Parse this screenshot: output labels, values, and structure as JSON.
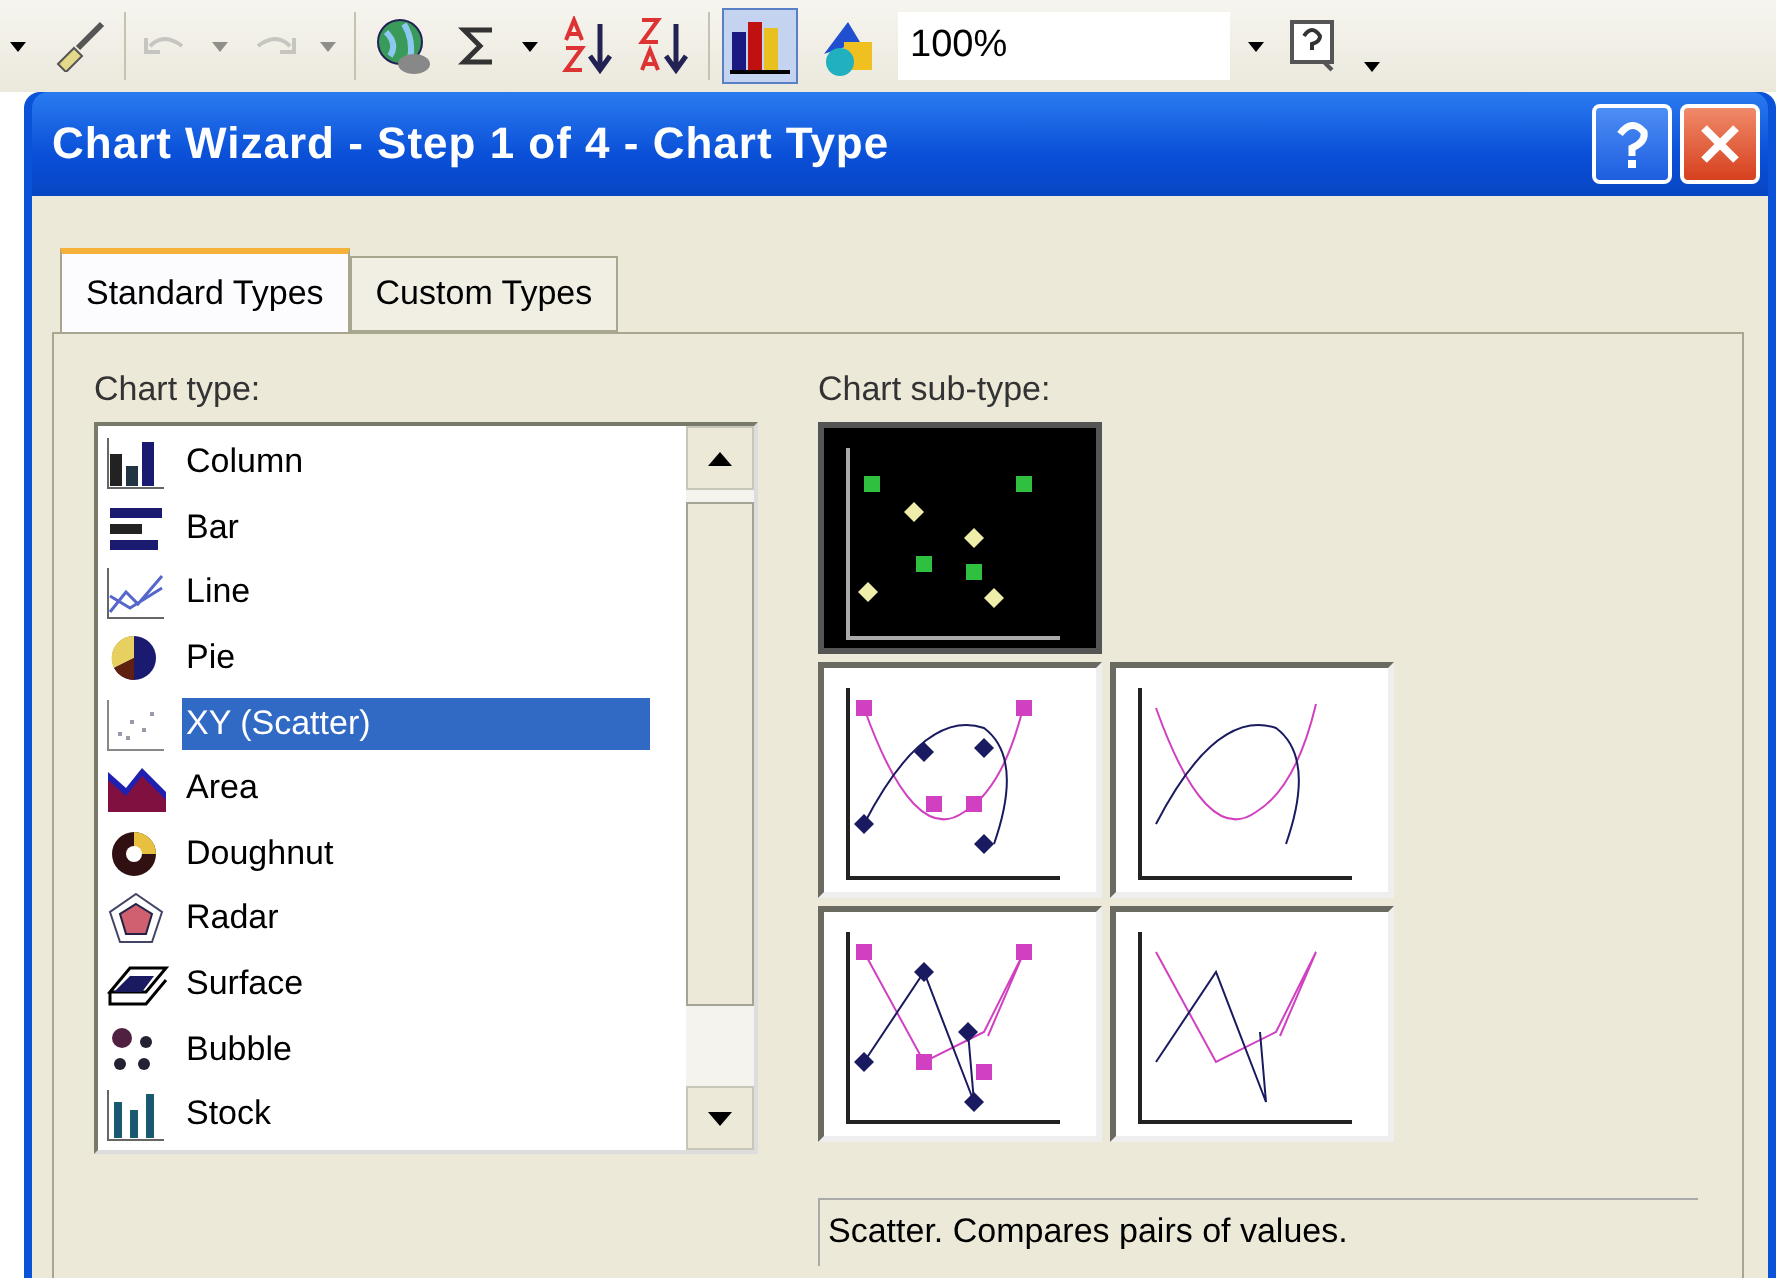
{
  "toolbar": {
    "buttons": [
      {
        "kind": "dropdown",
        "disabled": false,
        "pressed": false
      },
      {
        "kind": "brush",
        "disabled": false,
        "pressed": false
      },
      {
        "kind": "undo",
        "disabled": true,
        "pressed": false
      },
      {
        "kind": "dropdown",
        "disabled": true,
        "pressed": false
      },
      {
        "kind": "redo",
        "disabled": true,
        "pressed": false
      },
      {
        "kind": "dropdown",
        "disabled": true,
        "pressed": false
      },
      {
        "kind": "globe",
        "disabled": false,
        "pressed": false
      },
      {
        "kind": "sigma",
        "disabled": false,
        "pressed": false
      },
      {
        "kind": "dropdown",
        "disabled": false,
        "pressed": false
      },
      {
        "kind": "sortasc",
        "disabled": false,
        "pressed": false
      },
      {
        "kind": "sortdesc",
        "disabled": false,
        "pressed": false
      },
      {
        "kind": "chart",
        "disabled": false,
        "pressed": true
      },
      {
        "kind": "drawing",
        "disabled": false,
        "pressed": false
      }
    ],
    "zoom": {
      "value": "100%"
    },
    "trailing": [
      {
        "kind": "dropdown"
      },
      {
        "kind": "help"
      },
      {
        "kind": "more"
      }
    ]
  },
  "dialog": {
    "title": "Chart Wizard - Step 1 of 4 - Chart Type",
    "tabs": [
      {
        "label": "Standard Types",
        "selected": true
      },
      {
        "label": "Custom Types",
        "selected": false
      }
    ],
    "chart_type_label": "Chart type:",
    "chart_types": [
      {
        "label": "Column",
        "kind": "column",
        "selected": false
      },
      {
        "label": "Bar",
        "kind": "bar",
        "selected": false
      },
      {
        "label": "Line",
        "kind": "line",
        "selected": false
      },
      {
        "label": "Pie",
        "kind": "pie",
        "selected": false
      },
      {
        "label": "XY (Scatter)",
        "kind": "scatter",
        "selected": true
      },
      {
        "label": "Area",
        "kind": "area",
        "selected": false
      },
      {
        "label": "Doughnut",
        "kind": "doughnut",
        "selected": false
      },
      {
        "label": "Radar",
        "kind": "radar",
        "selected": false
      },
      {
        "label": "Surface",
        "kind": "surface",
        "selected": false
      },
      {
        "label": "Bubble",
        "kind": "bubble",
        "selected": false
      },
      {
        "label": "Stock",
        "kind": "stock",
        "selected": false
      }
    ],
    "subtype_label": "Chart sub-type:",
    "subtypes": [
      {
        "kind": "markers",
        "selected": true
      },
      {
        "kind": "smoothmarkers",
        "selected": false
      },
      {
        "kind": "smooth",
        "selected": false
      },
      {
        "kind": "linemarkers",
        "selected": false
      },
      {
        "kind": "lines",
        "selected": false
      }
    ],
    "description": "Scatter. Compares pairs of values."
  }
}
